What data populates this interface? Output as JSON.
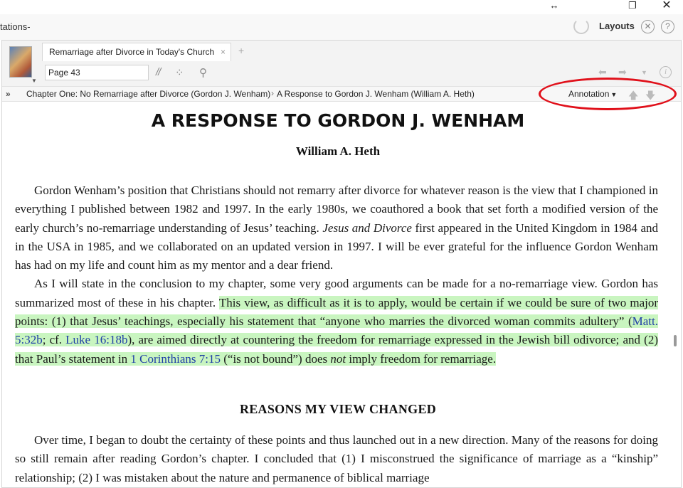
{
  "window": {
    "resize_icon": "↔",
    "restore_icon": "❐",
    "close_icon": "✕"
  },
  "app": {
    "title": "tations-",
    "layouts_label": "Layouts",
    "close_icon": "✕",
    "help_icon": "?"
  },
  "tab": {
    "label": "Remarriage after Divorce in Today's Church",
    "close": "×",
    "add": "+"
  },
  "toolbar": {
    "page_value": "Page 43",
    "parallel_icon": "//",
    "dots_icon": "⁘",
    "search_icon": "⚲",
    "back_icon": "⬅",
    "forward_icon": "➡",
    "dropdown_icon": "▼",
    "info_icon": "i"
  },
  "breadcrumb": {
    "more": "»",
    "item1": "Chapter One: No Remarriage after Divorce (Gordon J. Wenham)",
    "separator": "›",
    "item2": "A Response to Gordon J. Wenham (William A. Heth)",
    "annotation_label": "Annotation",
    "annotation_caret": "▼",
    "up_icon": "🡅",
    "down_icon": "🡇"
  },
  "document": {
    "title": "A RESPONSE TO GORDON J. WENHAM",
    "author": "William A. Heth",
    "p1": "Gordon Wenham’s position that Christians should not remarry after divorce for whatever reason is the view that I championed in everything I published between 1982 and 1997. In the early 1980s, we coauthored a book that set forth a modified version of the early church’s no-remarriage understanding of Jesus’ teaching.",
    "p1_book": "Jesus and Divorce",
    "p1_rest": "first appeared in the United Kingdom in 1984 and in the USA in 1985, and we collaborated on an updated version in 1997. I will be ever grateful for the influence Gordon Wenham has had on my life and count him as my mentor and a dear friend.",
    "p2_start": "As I will state in the conclusion to my chapter, some very good arguments can be made for a no-remarriage view. Gordon has summarized most of these in his chapter.",
    "p2_hl_a": "This view, as difficult as it is to apply, would be certain if we could be sure of two major points: (1) that Jesus’ teachings, especially his statement that “anyone who marries the divorced woman commits adultery” (",
    "p2_ref1": "Matt. 5:32b",
    "p2_hl_b": "; cf.",
    "p2_ref2": "Luke 16:18b",
    "p2_hl_c": "), are aimed directly at countering the freedom for remarriage expressed in the Jewish bill odivorce; and (2) that Paul’s statement in",
    "p2_ref3": "1 Corinthians 7:15",
    "p2_hl_d": "(“is not bound”) does",
    "p2_not": "not",
    "p2_hl_e": "imply freedom for remarriage.",
    "section_heading": "REASONS MY VIEW CHANGED",
    "p3": "Over time, I began to doubt the certainty of these points and thus launched out in a new direction. Many of the reasons for doing so still remain after reading Gordon’s chapter. I concluded that (1) I misconstrued the significance of marriage as a “kinship” relationship; (2) I was mistaken about the nature and permanence of biblical marriage"
  },
  "colors": {
    "highlight": "#c9f5c0",
    "reference": "#1f3fa6",
    "annotation_oval": "#e0101a"
  }
}
